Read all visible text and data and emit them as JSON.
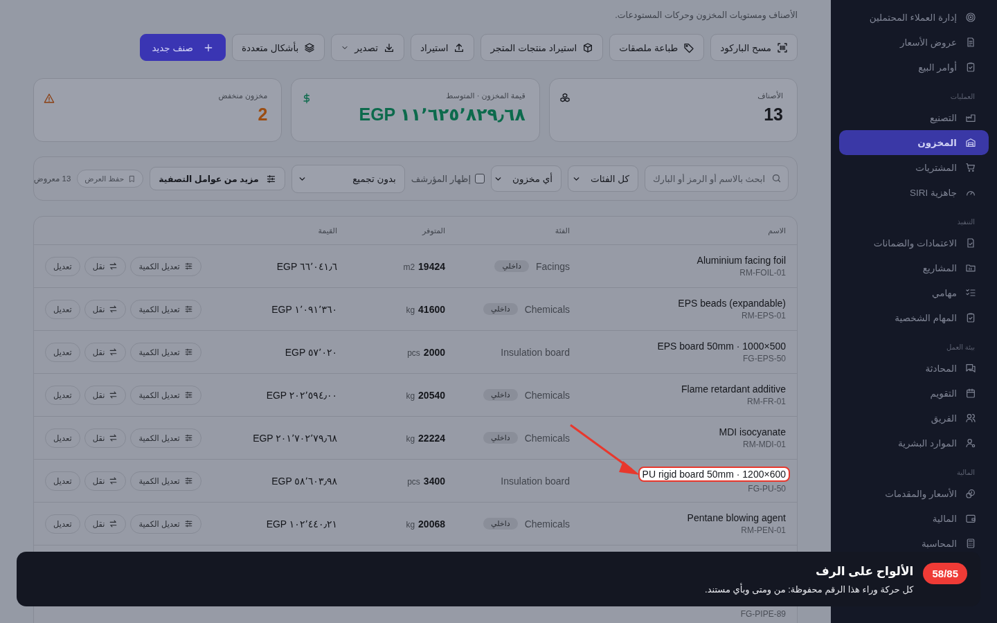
{
  "header": {
    "subtitle": "الأصناف ومستويات المخزون وحركات المستودعات."
  },
  "toolbar": [
    {
      "label": "مسح الباركود",
      "kind": "plain"
    },
    {
      "label": "طباعة ملصقات",
      "kind": "plain"
    },
    {
      "label": "استيراد منتجات المتجر",
      "kind": "plain"
    },
    {
      "label": "استيراد",
      "kind": "plain"
    },
    {
      "label": "تصدير",
      "kind": "dropdown"
    },
    {
      "label": "بأشكال متعددة",
      "kind": "plain"
    },
    {
      "label": "صنف جديد",
      "kind": "primary"
    }
  ],
  "stats": [
    {
      "label": "الأصناف",
      "value": "13",
      "kind": "count"
    },
    {
      "label": "قيمة المخزون · المتوسط",
      "value": "EGP ١١٬٦٢٥٬٨٢٩٫٦٨",
      "kind": "money"
    },
    {
      "label": "مخزون منخفض",
      "value": "2",
      "kind": "warning"
    }
  ],
  "filters": [
    {
      "kind": "search",
      "placeholder": "ابحث بالاسم أو الرمز أو البارك"
    },
    {
      "kind": "select",
      "value": "كل الفئات"
    },
    {
      "kind": "select",
      "value": "أي مخزون"
    },
    {
      "kind": "checkbox",
      "label": "إظهار المؤرشف",
      "checked": false
    },
    {
      "kind": "select",
      "value": "بدون تجميع"
    },
    {
      "kind": "button",
      "label": "مزيد من عوامل التصفية"
    },
    {
      "kind": "chip",
      "label": "حفظ العرض"
    },
    {
      "kind": "count",
      "label": "13 معروض"
    }
  ],
  "table": {
    "columns": [
      "الاسم",
      "الفئة",
      "المتوفر",
      "القيمة"
    ],
    "rows": [
      {
        "name": "Aluminium facing foil",
        "sku": "RM-FOIL-01",
        "category": "Facings",
        "tag": "داخلي",
        "qty": "19424",
        "unit": "m2",
        "value": "EGP ٦٦٬٠٤١٫٦",
        "actions": [
          "تعديل الكمية",
          "نقل",
          "تعديل"
        ],
        "highlighted": false
      },
      {
        "name": "EPS beads (expandable)",
        "sku": "RM-EPS-01",
        "category": "Chemicals",
        "tag": "داخلي",
        "qty": "41600",
        "unit": "kg",
        "value": "EGP ١٬٠٩١٬٣٦٠",
        "actions": [
          "تعديل الكمية",
          "نقل",
          "تعديل"
        ],
        "highlighted": false
      },
      {
        "name": "EPS board 50mm · 1000×500",
        "sku": "FG-EPS-50",
        "category": "Insulation board",
        "qty": "2000",
        "unit": "pcs",
        "value": "EGP ٥٧٬٠٢٠",
        "actions": [
          "تعديل الكمية",
          "نقل",
          "تعديل"
        ],
        "highlighted": false
      },
      {
        "name": "Flame retardant additive",
        "sku": "RM-FR-01",
        "category": "Chemicals",
        "tag": "داخلي",
        "qty": "20540",
        "unit": "kg",
        "value": "EGP ٢٠٢٬٥٩٤٫٠٠",
        "actions": [
          "تعديل الكمية",
          "نقل",
          "تعديل"
        ],
        "highlighted": false
      },
      {
        "name": "MDI isocyanate",
        "sku": "RM-MDI-01",
        "category": "Chemicals",
        "tag": "داخلي",
        "qty": "22224",
        "unit": "kg",
        "value": "EGP ٢٠١٬٧٠٢٬٧٩٫٦٨",
        "actions": [
          "تعديل الكمية",
          "نقل",
          "تعديل"
        ],
        "highlighted": false
      },
      {
        "name": "PU rigid board 50mm · 1200×600",
        "sku": "FG-PU-50",
        "category": "Insulation board",
        "qty": "3400",
        "unit": "pcs",
        "value": "EGP ٥٨٬٦٠٣٫٩٨",
        "actions": [
          "تعديل الكمية",
          "نقل",
          "تعديل"
        ],
        "highlighted": true
      },
      {
        "name": "Pentane blowing agent",
        "sku": "RM-PEN-01",
        "category": "Chemicals",
        "tag": "داخلي",
        "qty": "20068",
        "unit": "kg",
        "value": "EGP ١٠٢٬٤٤٠٫٢١",
        "actions": [
          "تعديل الكمية",
          "نقل",
          "تعديل"
        ],
        "highlighted": false
      },
      {
        "kind": "partial",
        "sku": "FG-PIPE-89"
      }
    ]
  },
  "sidebar": {
    "sections": [
      {
        "items": [
          {
            "label": "إدارة العملاء المحتملين",
            "selected": false
          },
          {
            "label": "عروض الأسعار",
            "selected": false
          },
          {
            "label": "أوامر البيع",
            "selected": false
          }
        ]
      },
      {
        "title": "العمليات",
        "items": [
          {
            "label": "التصنيع",
            "selected": false
          },
          {
            "label": "المخزون",
            "selected": true
          },
          {
            "label": "المشتريات",
            "selected": false
          },
          {
            "label": "جاهزية SIRI",
            "selected": false
          }
        ]
      },
      {
        "title": "التنفيذ",
        "items": [
          {
            "label": "الاعتمادات والضمانات",
            "selected": false
          },
          {
            "label": "المشاريع",
            "selected": false
          },
          {
            "label": "مهامي",
            "selected": false
          },
          {
            "label": "المهام الشخصية",
            "selected": false
          }
        ]
      },
      {
        "title": "بيئة العمل",
        "items": [
          {
            "label": "المحادثة",
            "selected": false
          },
          {
            "label": "التقويم",
            "selected": false
          },
          {
            "label": "الفريق",
            "selected": false
          },
          {
            "label": "الموارد البشرية",
            "selected": false
          }
        ]
      },
      {
        "title": "المالية",
        "items": [
          {
            "label": "الأسعار والمقدمات",
            "selected": false
          },
          {
            "label": "المالية",
            "selected": false
          },
          {
            "label": "المحاسبة",
            "selected": false
          }
        ]
      }
    ]
  },
  "toast": {
    "badge": "58/85",
    "title": "الألواح على الرف",
    "text": "كل حركة وراء هذا الرقم محفوظة: من ومتى وبأي مستند."
  }
}
